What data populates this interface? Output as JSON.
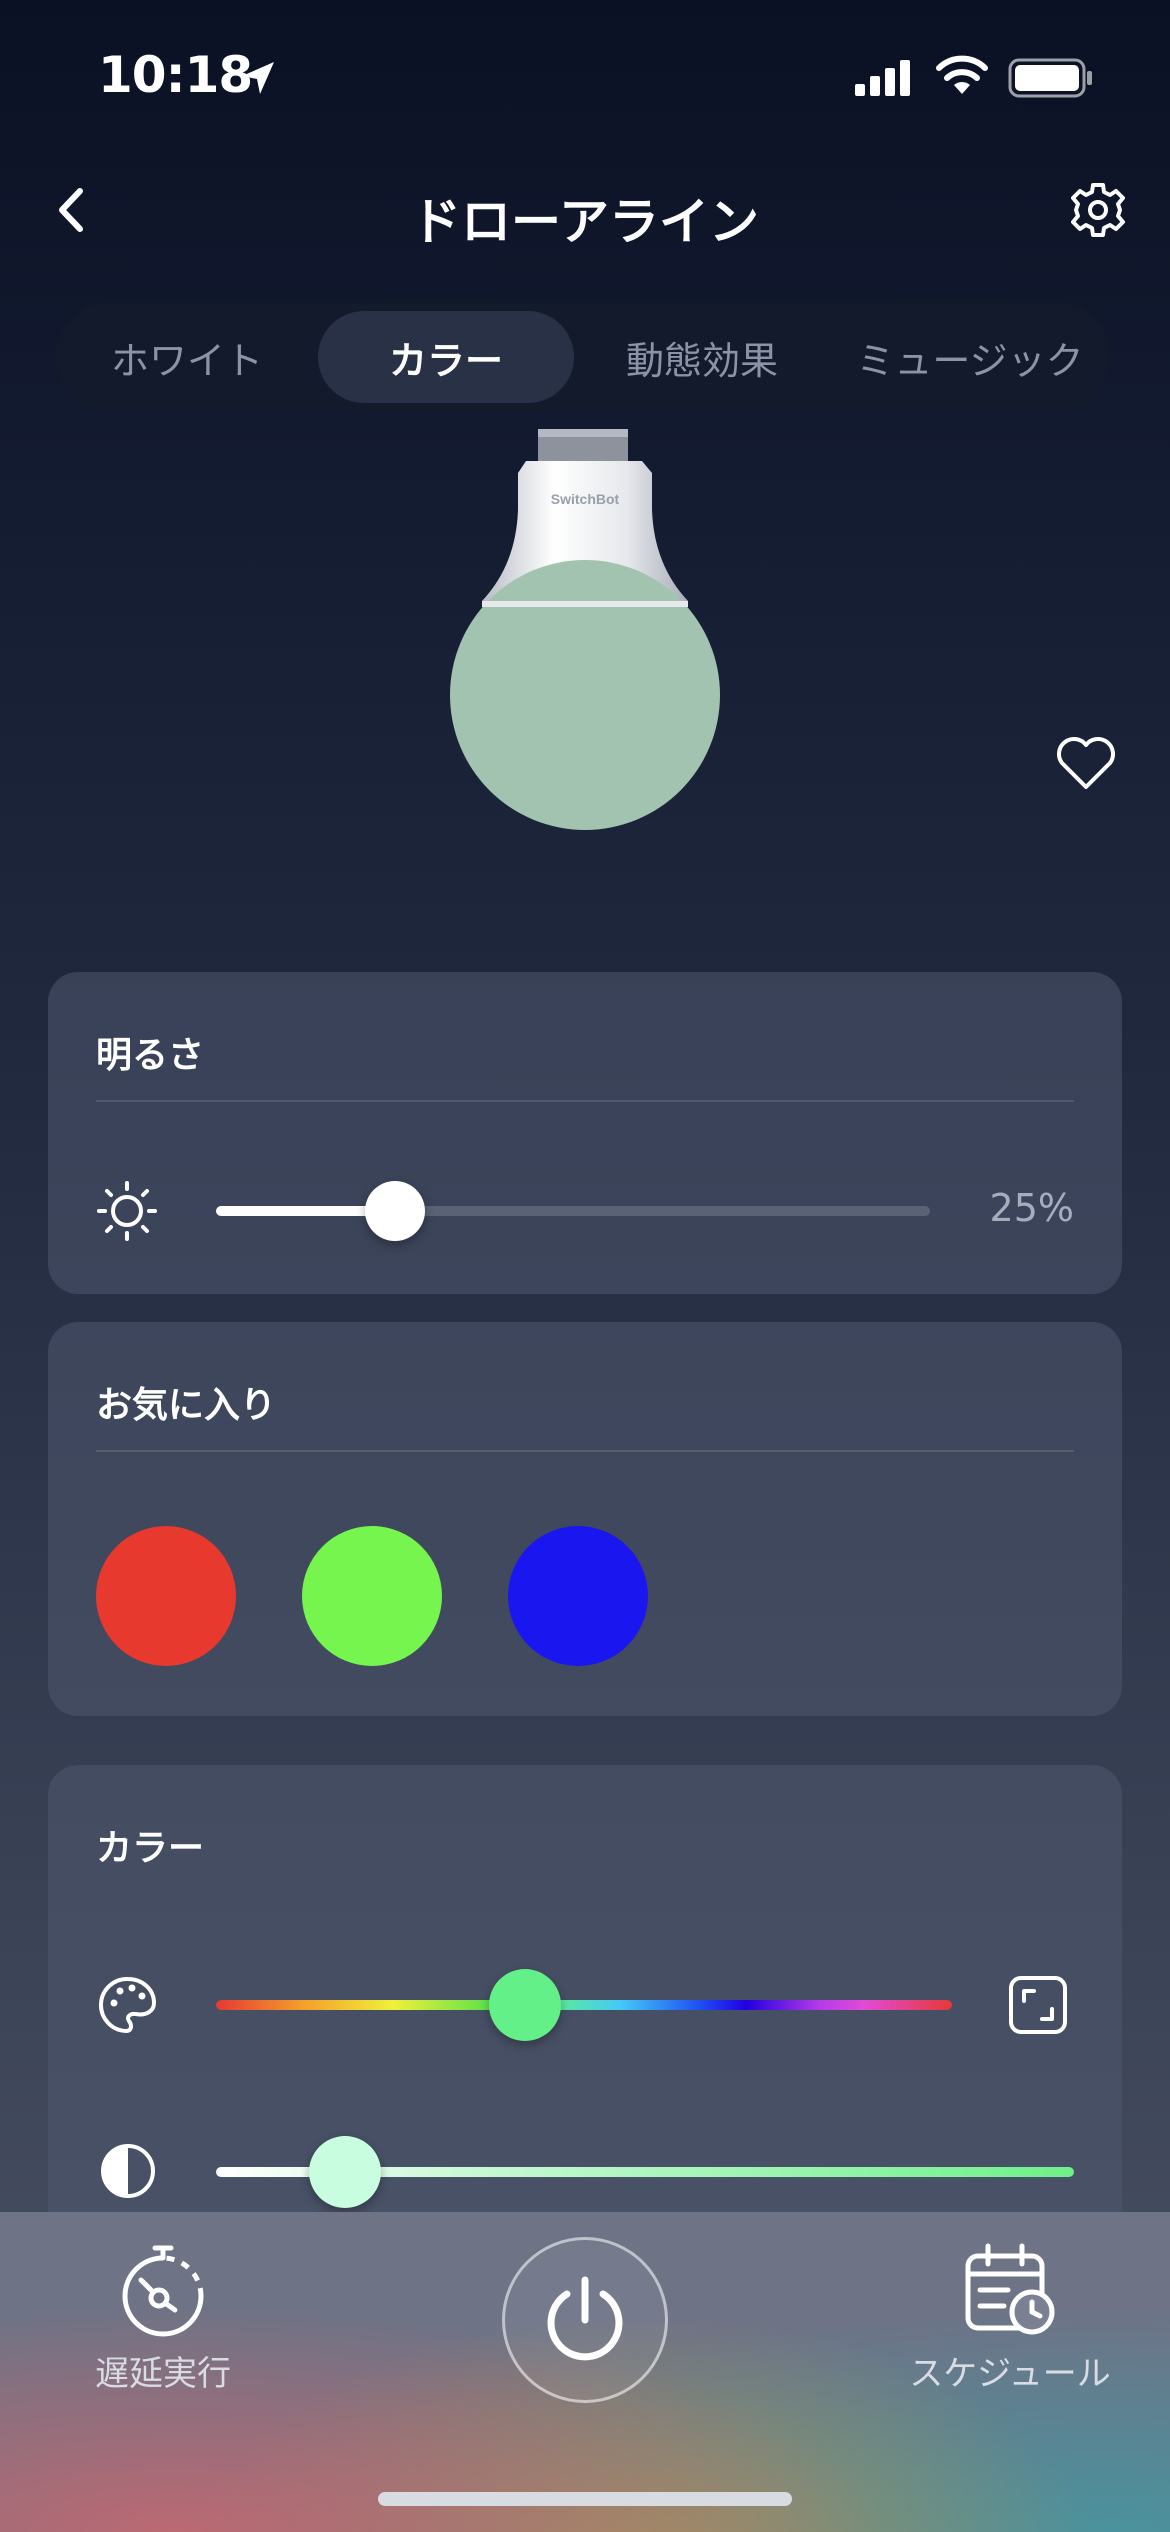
{
  "status_bar": {
    "time": "10:18"
  },
  "nav": {
    "title": "ドローアライン"
  },
  "tabs": [
    {
      "label": "ホワイト",
      "active": false
    },
    {
      "label": "カラー",
      "active": true
    },
    {
      "label": "動態効果",
      "active": false
    },
    {
      "label": "ミュージック",
      "active": false
    }
  ],
  "bulb": {
    "brand": "SwitchBot",
    "color": "#a1c3b0"
  },
  "brightness": {
    "title": "明るさ",
    "value_label": "25%",
    "value": 0.25
  },
  "favorites": {
    "title": "お気に入り",
    "swatches": [
      {
        "name": "red",
        "color": "#e8392f"
      },
      {
        "name": "green",
        "color": "#77f54f"
      },
      {
        "name": "blue",
        "color": "#1a16ef"
      }
    ]
  },
  "color": {
    "title": "カラー",
    "hue_position": 0.42,
    "hue_knob_color": "#64f088",
    "saturation_position": 0.15
  },
  "bottom_bar": {
    "timer_label": "遅延実行",
    "schedule_label": "スケジュール"
  }
}
